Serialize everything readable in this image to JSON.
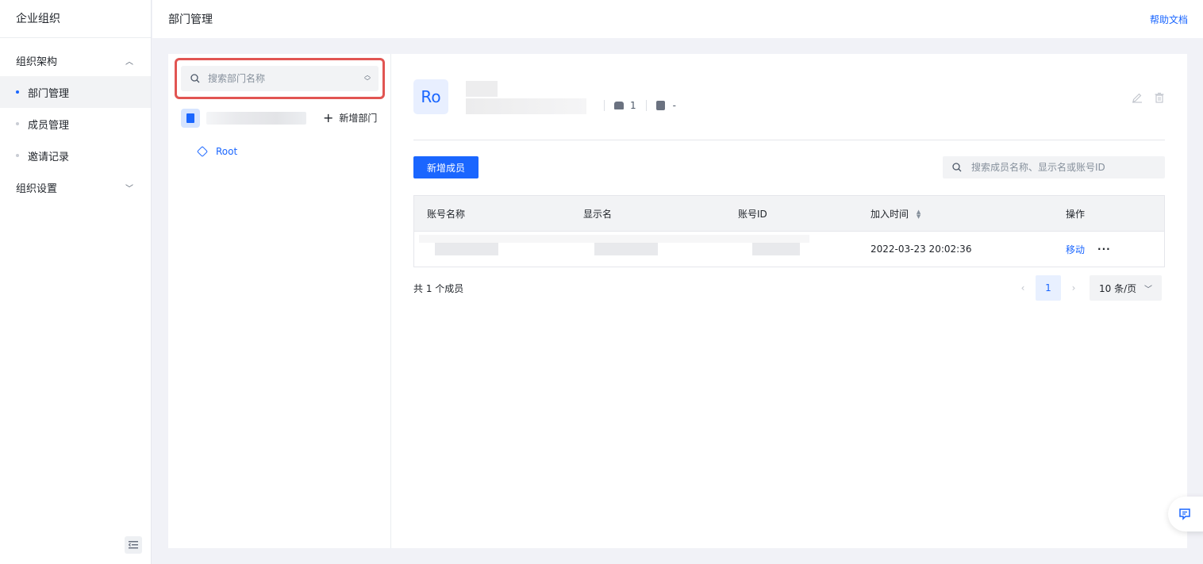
{
  "sidebar": {
    "title": "企业组织",
    "group_org": "组织架构",
    "items": [
      {
        "label": "部门管理",
        "active": true
      },
      {
        "label": "成员管理",
        "active": false
      },
      {
        "label": "邀请记录",
        "active": false
      }
    ],
    "group_settings": "组织设置"
  },
  "header": {
    "title": "部门管理",
    "help": "帮助文档"
  },
  "dept_panel": {
    "search_placeholder": "搜索部门名称",
    "add_dept": "新增部门",
    "root": "Root"
  },
  "dept_detail": {
    "avatar": "Ro",
    "member_count": "1",
    "description": "-"
  },
  "members": {
    "add_button": "新增成员",
    "search_placeholder": "搜索成员名称、显示名或账号ID",
    "columns": [
      "账号名称",
      "显示名",
      "账号ID",
      "加入时间",
      "操作"
    ],
    "rows": [
      {
        "join_time": "2022-03-23 20:02:36",
        "action_move": "移动",
        "action_more": "···"
      }
    ],
    "total": "共 1 个成员"
  },
  "pagination": {
    "current": "1",
    "page_size": "10 条/页"
  },
  "colors": {
    "accent": "#1a66ff",
    "highlight_border": "#e15552"
  }
}
